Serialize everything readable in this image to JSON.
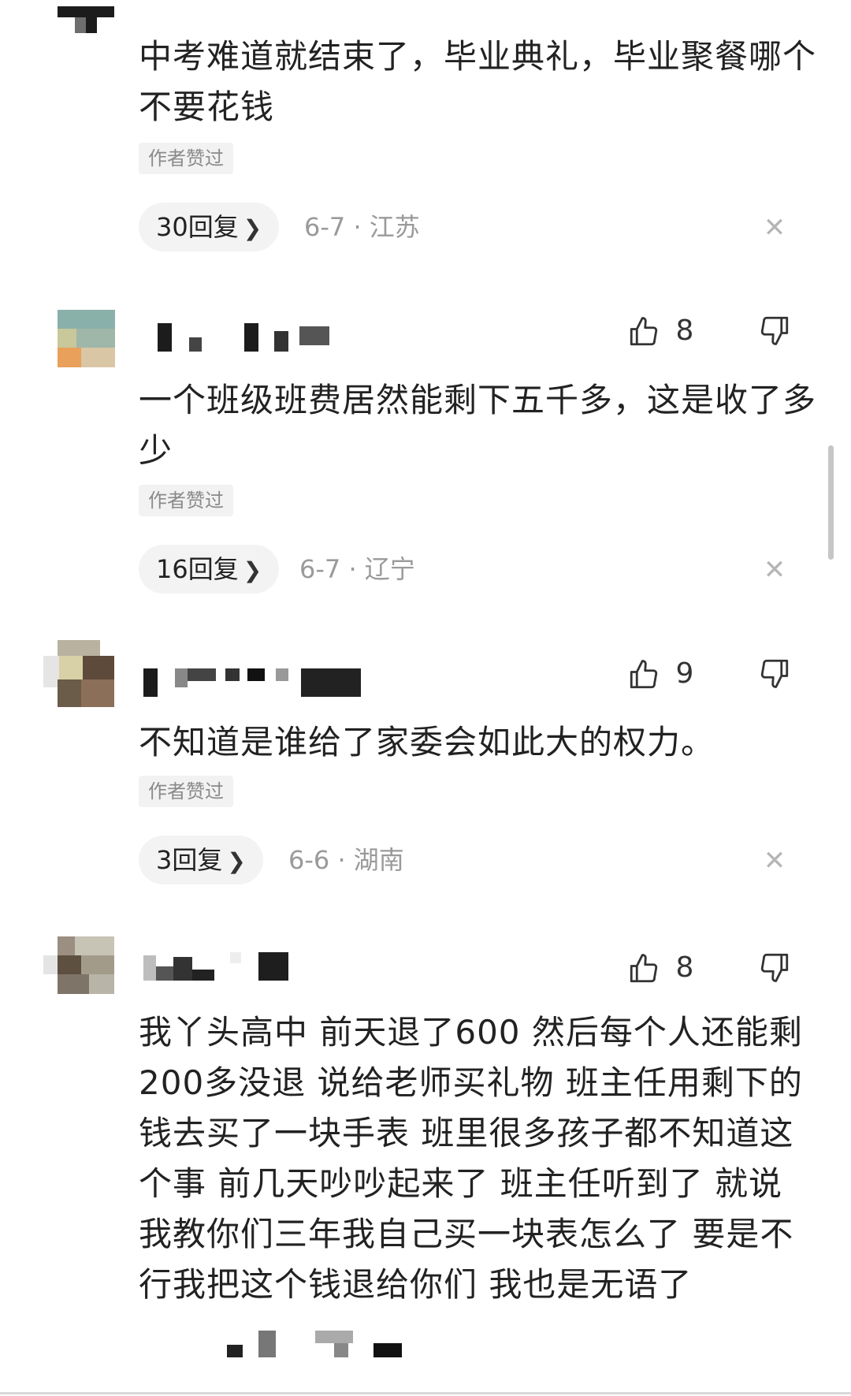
{
  "comments": [
    {
      "text": "中考难道就结束了，毕业典礼，毕业聚餐哪个不要花钱",
      "author_tag": "作者赞过",
      "replies_label": "30回复",
      "meta": "6-7 · 江苏"
    },
    {
      "likes": "8",
      "text": "一个班级班费居然能剩下五千多，这是收了多少",
      "author_tag": "作者赞过",
      "replies_label": "16回复",
      "meta": "6-7 · 辽宁"
    },
    {
      "likes": "9",
      "text": "不知道是谁给了家委会如此大的权力。",
      "author_tag": "作者赞过",
      "replies_label": "3回复",
      "meta": "6-6 · 湖南"
    },
    {
      "likes": "8",
      "text": "我丫头高中 前天退了600 然后每个人还能剩200多没退 说给老师买礼物 班主任用剩下的钱去买了一块手表 班里很多孩子都不知道这个事 前几天吵吵起来了 班主任听到了 就说我教你们三年我自己买一块表怎么了 要是不行我把这个钱退给你们 我也是无语了"
    }
  ],
  "icons": {
    "like": "thumbs-up-icon",
    "dislike": "thumbs-down-icon",
    "close": "close-icon",
    "chevron": "chevron-right-icon"
  }
}
